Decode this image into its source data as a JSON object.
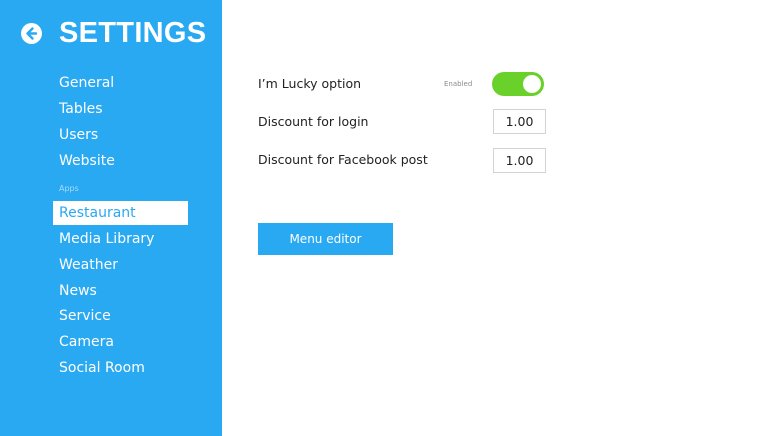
{
  "sidebar": {
    "title": "SETTINGS",
    "back_icon": "arrow-left-circle-icon",
    "items": [
      {
        "label": "General"
      },
      {
        "label": "Tables"
      },
      {
        "label": "Users"
      },
      {
        "label": "Website"
      }
    ],
    "apps_section_label": "Apps",
    "app_items": [
      {
        "label": "Restaurant",
        "active": true
      },
      {
        "label": "Media Library"
      },
      {
        "label": "Weather"
      },
      {
        "label": "News"
      },
      {
        "label": "Service"
      },
      {
        "label": "Camera"
      },
      {
        "label": "Social Room"
      }
    ]
  },
  "main": {
    "lucky_option": {
      "label": "I’m Lucky option",
      "status_text": "Enabled",
      "enabled": true
    },
    "discount_login": {
      "label": "Discount for login",
      "value": "1.00"
    },
    "discount_facebook": {
      "label": "Discount for Facebook post",
      "value": "1.00"
    },
    "menu_editor_label": "Menu editor"
  },
  "colors": {
    "accent": "#29a9f2",
    "toggle_on": "#6ad02a",
    "background": "#ffffff"
  }
}
